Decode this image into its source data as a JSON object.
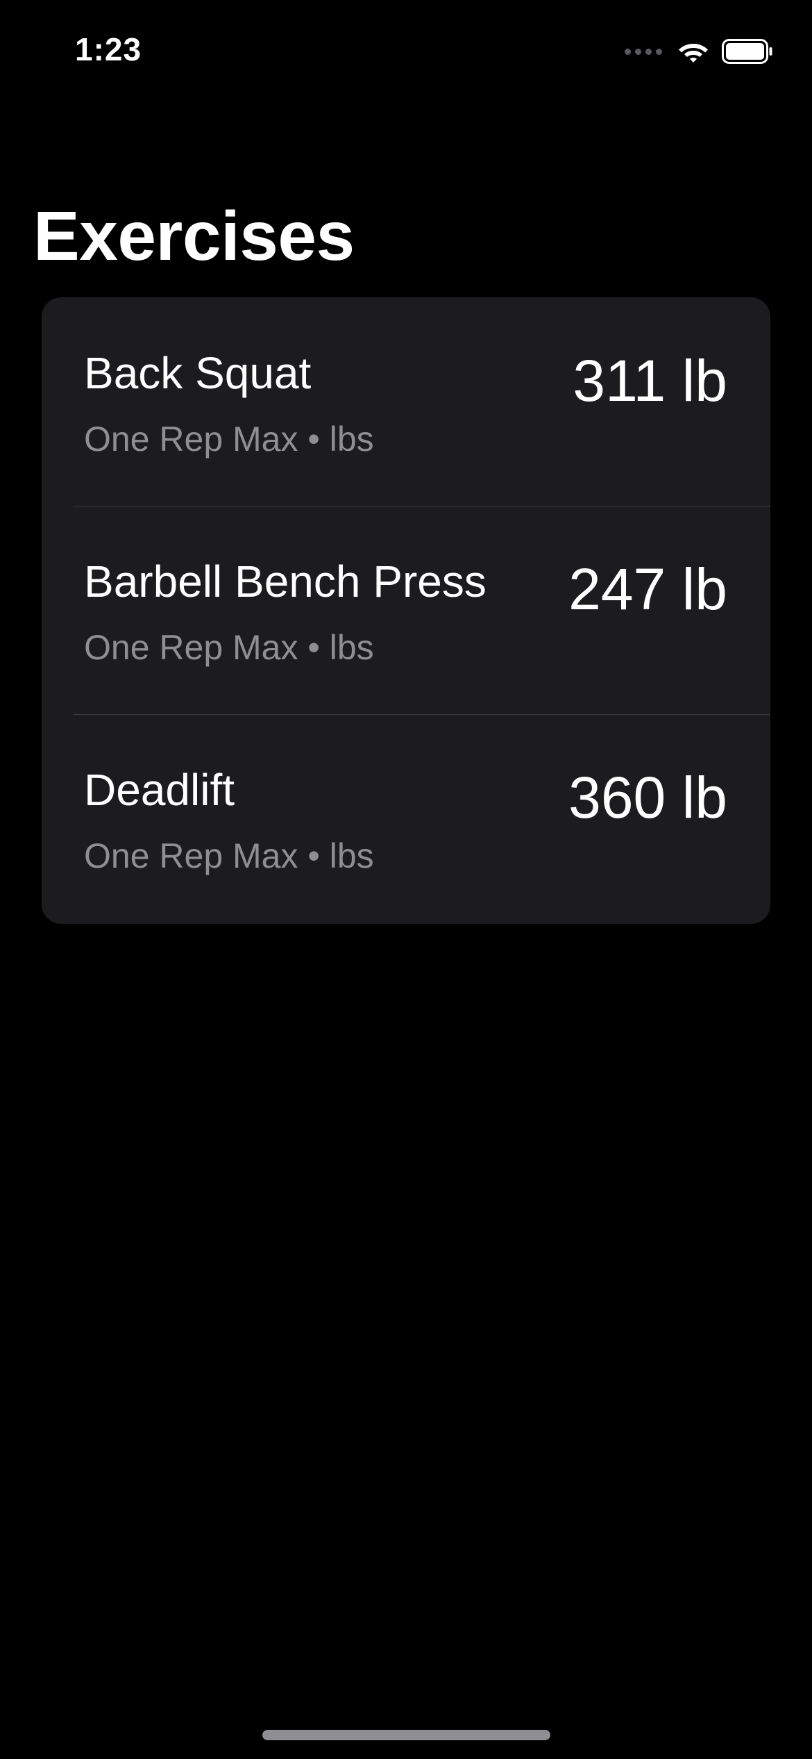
{
  "status_bar": {
    "time": "1:23",
    "icons": [
      "signal-icon",
      "wifi-icon",
      "battery-icon"
    ]
  },
  "page": {
    "title": "Exercises"
  },
  "exercises": [
    {
      "name": "Back Squat",
      "subtitle": "One Rep Max • lbs",
      "value": "311 lb"
    },
    {
      "name": "Barbell Bench Press",
      "subtitle": "One Rep Max • lbs",
      "value": "247 lb"
    },
    {
      "name": "Deadlift",
      "subtitle": "One Rep Max • lbs",
      "value": "360 lb"
    }
  ],
  "colors": {
    "background": "#000000",
    "card": "#1c1c1e",
    "secondary_text": "#8e8e93",
    "separator": "#38383a"
  }
}
